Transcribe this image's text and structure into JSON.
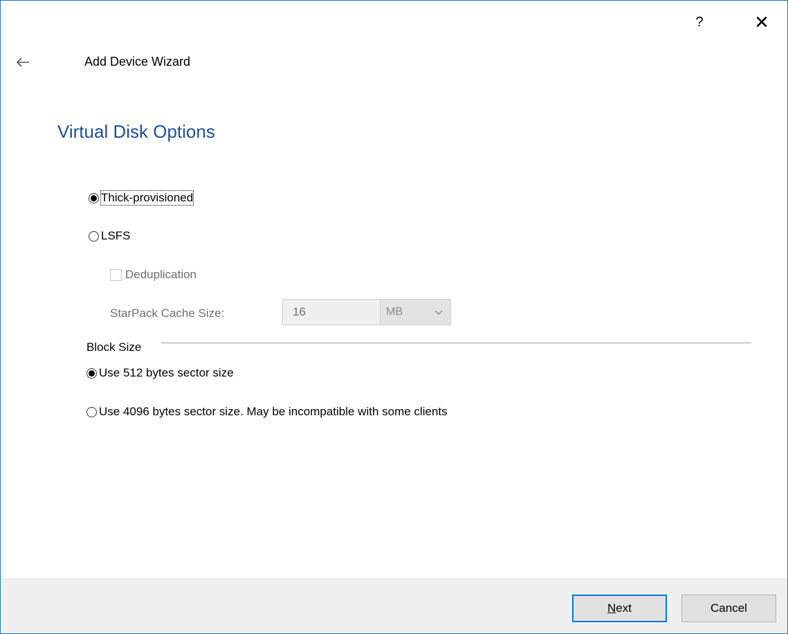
{
  "window": {
    "help_label": "?",
    "close_label": "✕"
  },
  "header": {
    "title": "Add Device Wizard"
  },
  "page": {
    "heading": "Virtual Disk Options"
  },
  "provisioning": {
    "options": [
      {
        "label": "Thick-provisioned",
        "selected": true
      },
      {
        "label": "LSFS",
        "selected": false
      }
    ],
    "deduplication_label": "Deduplication",
    "deduplication_checked": false,
    "cache_label": "StarPack Cache Size:",
    "cache_value": "16",
    "cache_unit": "MB"
  },
  "block_size": {
    "group_label": "Block Size",
    "options": [
      {
        "label": "Use 512 bytes sector size",
        "selected": true
      },
      {
        "label": "Use 4096 bytes sector size. May be incompatible with some clients",
        "selected": false
      }
    ]
  },
  "footer": {
    "next_label_rest": "ext",
    "next_mnemonic": "N",
    "cancel_label": "Cancel"
  },
  "colors": {
    "heading": "#1f4e99",
    "accent": "#0078d7",
    "window_border": "#1979ca"
  },
  "icons": {
    "back": "back-arrow-icon",
    "close": "close-icon",
    "help": "help-icon",
    "dropdown": "chevron-down-icon"
  }
}
